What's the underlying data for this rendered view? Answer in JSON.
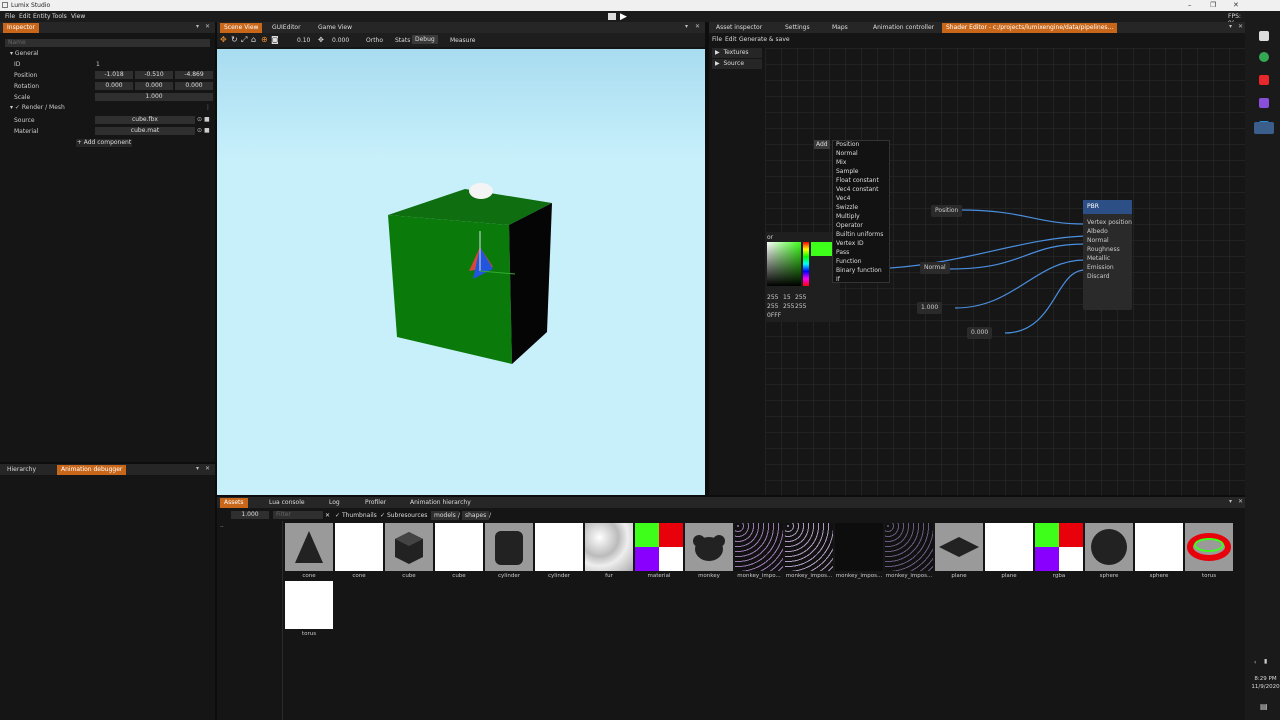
{
  "app": {
    "title": "Lumix Studio",
    "fps": "FPS: 9("
  },
  "menu": [
    "File",
    "Edit",
    "Entity",
    "Tools",
    "View"
  ],
  "viewport_tabs": [
    "Scene View",
    "GUIEditor",
    "Game View"
  ],
  "viewport_toolbar": {
    "speed": "0.10",
    "value": "0.000",
    "ortho": "Ortho",
    "stats": "Stats",
    "debug": "Debug",
    "measure": "Measure"
  },
  "inspector": {
    "tab": "Inspector",
    "name_placeholder": "Name",
    "general": "General",
    "id_label": "ID",
    "id_value": "1",
    "position_label": "Position",
    "position": [
      "-1.018",
      "-0.510",
      "-4.869"
    ],
    "rotation_label": "Rotation",
    "rotation": [
      "0.000",
      "0.000",
      "0.000"
    ],
    "scale_label": "Scale",
    "scale": "1.000",
    "render_mesh": "Render / Mesh",
    "source_label": "Source",
    "source_value": "cube.fbx",
    "material_label": "Material",
    "material_value": "cube.mat",
    "add_component": "Add component"
  },
  "hierarchy_tabs": [
    "Hierarchy",
    "Animation debugger"
  ],
  "right_tabs": [
    "Asset inspector",
    "Settings",
    "Maps",
    "Animation controller",
    "Shader Editor - c:/projects/lumixengine/data/pipelines..."
  ],
  "shader": {
    "menu": [
      "File",
      "Edit",
      "Generate & save"
    ],
    "tree": [
      "Textures",
      "Source"
    ],
    "context_add": "Add",
    "context_items": [
      "Position",
      "Normal",
      "Mix",
      "Sample",
      "Float constant",
      "Vec4 constant",
      "Vec4",
      "Swizzle",
      "Multiply",
      "Operator",
      "Builtin uniforms",
      "Vertex ID",
      "Pass",
      "Function",
      "Binary function",
      "If"
    ],
    "nodes": {
      "position": "Position",
      "normal": "Normal",
      "const1": "1.000",
      "const2": "0.000"
    },
    "pbr": {
      "title": "PBR",
      "inputs": [
        "Vertex position",
        "Albedo",
        "Normal",
        "Roughness",
        "Metallic",
        "Emission",
        "Discard"
      ]
    },
    "picker": {
      "label": "or",
      "row1": [
        "255",
        "15",
        "255"
      ],
      "row2": [
        "255",
        "255",
        "255"
      ],
      "hex": "0FFF"
    }
  },
  "bottom_tabs": [
    "Assets",
    "Lua console",
    "Log",
    "Profiler",
    "Animation hierarchy"
  ],
  "assets": {
    "zoom": "1.000",
    "filter_placeholder": "Filter",
    "thumbnails": "Thumbnails",
    "subresources": "Subresources",
    "breadcrumb": [
      "models",
      "/",
      "shapes",
      "/"
    ],
    "tree_item": "..",
    "items": [
      "cone",
      "cone",
      "cube",
      "cube",
      "cylinder",
      "cylinder",
      "fur",
      "material",
      "monkey",
      "monkey_impo...",
      "monkey_impos...",
      "monkey_impos...",
      "monkey_impos...",
      "plane",
      "plane",
      "rgba",
      "sphere",
      "sphere",
      "torus",
      "torus"
    ]
  },
  "clock": {
    "time": "8:29 PM",
    "date": "11/9/2020"
  }
}
